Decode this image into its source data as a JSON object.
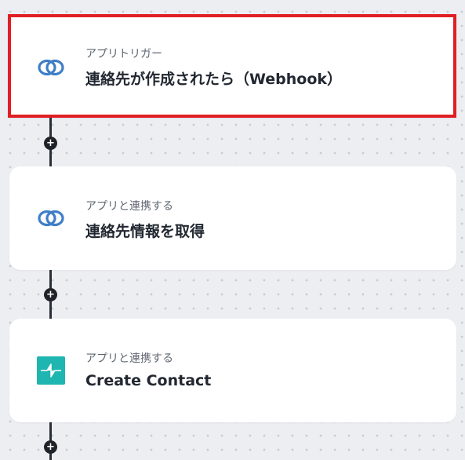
{
  "flow": {
    "steps": [
      {
        "subtitle": "アプリトリガー",
        "title": "連絡先が作成されたら（Webhook）",
        "icon": "link-rings-icon",
        "selected": true,
        "accent": "#e01f25"
      },
      {
        "subtitle": "アプリと連携する",
        "title": "連絡先情報を取得",
        "icon": "link-rings-icon",
        "selected": false
      },
      {
        "subtitle": "アプリと連携する",
        "title": "Create Contact",
        "icon": "teal-app-icon",
        "selected": false,
        "accent": "#1fb5b0"
      }
    ],
    "add_step_symbol": "+"
  }
}
